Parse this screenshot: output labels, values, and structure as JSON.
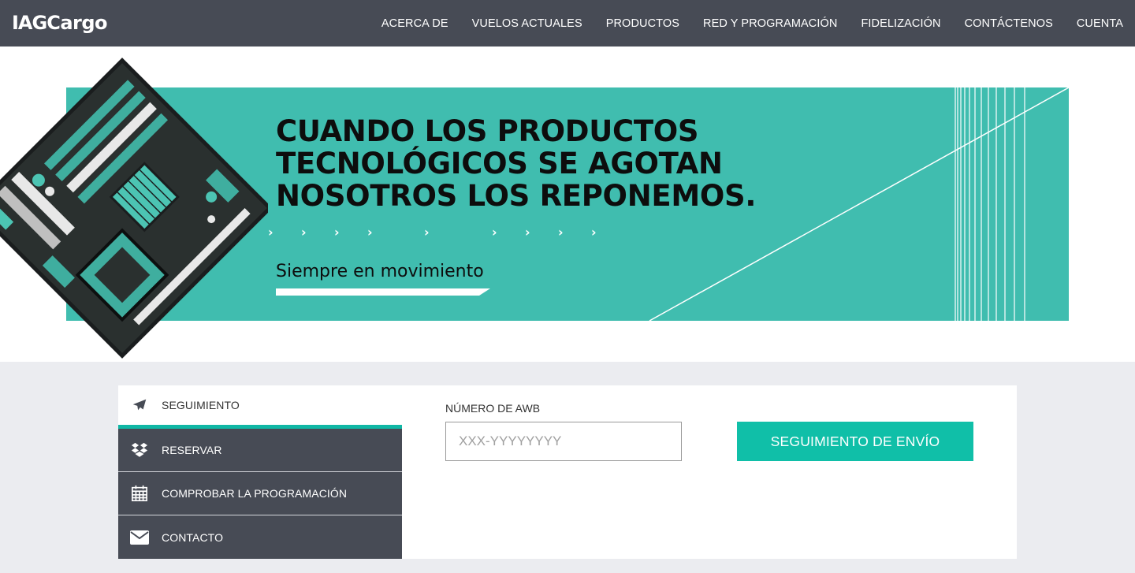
{
  "brand": {
    "logo_iag": "IAG",
    "logo_cargo": "Cargo"
  },
  "nav": {
    "items": [
      {
        "label": "ACERCA DE"
      },
      {
        "label": "VUELOS ACTUALES"
      },
      {
        "label": "PRODUCTOS"
      },
      {
        "label": "RED Y PROGRAMACIÓN"
      },
      {
        "label": "FIDELIZACIÓN"
      },
      {
        "label": "CONTÁCTENOS"
      },
      {
        "label": "CUENTA"
      }
    ]
  },
  "hero": {
    "headline_lines": [
      "CUANDO LOS PRODUCTOS",
      "TECNOLÓGICOS SE AGOTAN",
      "NOSOTROS LOS REPONEMOS."
    ],
    "chevron_glyph": "›",
    "tagline": "Siempre en movimiento",
    "banner_color": "#40bdaf"
  },
  "tools": {
    "menu": [
      {
        "label": "SEGUIMIENTO",
        "icon": "plane-icon",
        "active": true
      },
      {
        "label": "RESERVAR",
        "icon": "dropbox-icon",
        "active": false
      },
      {
        "label": "COMPROBAR LA PROGRAMACIÓN",
        "icon": "calendar-icon",
        "active": false
      },
      {
        "label": "CONTACTO",
        "icon": "envelope-icon",
        "active": false
      }
    ],
    "awb_label": "NÚMERO DE AWB",
    "awb_placeholder": "XXX-YYYYYYYY",
    "awb_value": "",
    "track_button": "SEGUIMIENTO DE ENVÍO",
    "accent_color": "#10bfa8",
    "menu_color": "#474b55"
  }
}
